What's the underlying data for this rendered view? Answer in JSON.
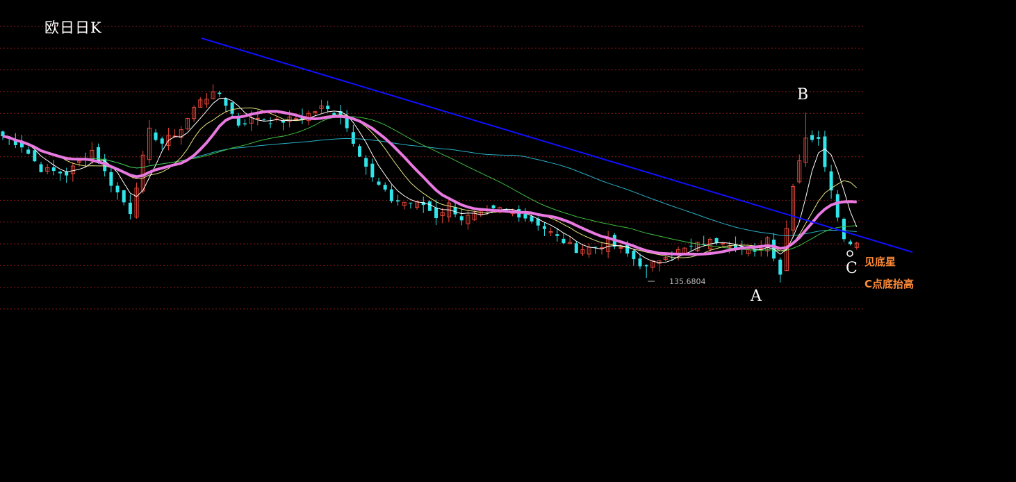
{
  "chart_data": {
    "type": "candlestick",
    "title": "欧日日K",
    "colors": {
      "up": "#e8483a",
      "down": "#30e4ea",
      "grid": "#8a1a1a",
      "trendline": "#1010ff",
      "ma_main": "#e879e0",
      "ma_white": "#ffffff",
      "ma_yellow": "#e6e680",
      "ma_green": "#40c040",
      "ma_cyan": "#2ab0c8",
      "label": "#ffffff",
      "note": "#ff8c3a"
    },
    "annotations": {
      "point_a": "A",
      "point_b": "B",
      "point_c": "C",
      "note_1": "见底星",
      "note_2": "C点底抬高",
      "low_value": "135.6804"
    },
    "trend_line": {
      "from_index": 6,
      "to_index": 145
    },
    "swing_points": {
      "A_index": 122,
      "B_index": 126,
      "C_index": 132,
      "low_index": 101
    },
    "price_min": 135.6804,
    "anchors_close": [
      [
        0,
        0.6
      ],
      [
        3,
        0.56
      ],
      [
        6,
        0.46
      ],
      [
        10,
        0.44
      ],
      [
        14,
        0.54
      ],
      [
        17,
        0.4
      ],
      [
        20,
        0.28
      ],
      [
        23,
        0.62
      ],
      [
        25,
        0.57
      ],
      [
        28,
        0.63
      ],
      [
        31,
        0.76
      ],
      [
        34,
        0.78
      ],
      [
        37,
        0.65
      ],
      [
        40,
        0.68
      ],
      [
        43,
        0.66
      ],
      [
        47,
        0.68
      ],
      [
        50,
        0.72
      ],
      [
        53,
        0.69
      ],
      [
        55,
        0.58
      ],
      [
        58,
        0.42
      ],
      [
        61,
        0.33
      ],
      [
        63,
        0.32
      ],
      [
        66,
        0.31
      ],
      [
        68,
        0.26
      ],
      [
        70,
        0.31
      ],
      [
        72,
        0.25
      ],
      [
        75,
        0.27
      ],
      [
        78,
        0.29
      ],
      [
        81,
        0.27
      ],
      [
        84,
        0.23
      ],
      [
        87,
        0.17
      ],
      [
        90,
        0.12
      ],
      [
        93,
        0.13
      ],
      [
        95,
        0.15
      ],
      [
        98,
        0.1
      ],
      [
        101,
        0.04
      ],
      [
        104,
        0.1
      ],
      [
        107,
        0.12
      ],
      [
        110,
        0.15
      ],
      [
        113,
        0.16
      ],
      [
        116,
        0.12
      ],
      [
        118,
        0.1
      ],
      [
        120,
        0.17
      ],
      [
        122,
        0.02
      ],
      [
        124,
        0.4
      ],
      [
        126,
        0.6
      ],
      [
        128,
        0.58
      ],
      [
        130,
        0.38
      ],
      [
        132,
        0.16
      ],
      [
        134,
        0.15
      ]
    ]
  }
}
